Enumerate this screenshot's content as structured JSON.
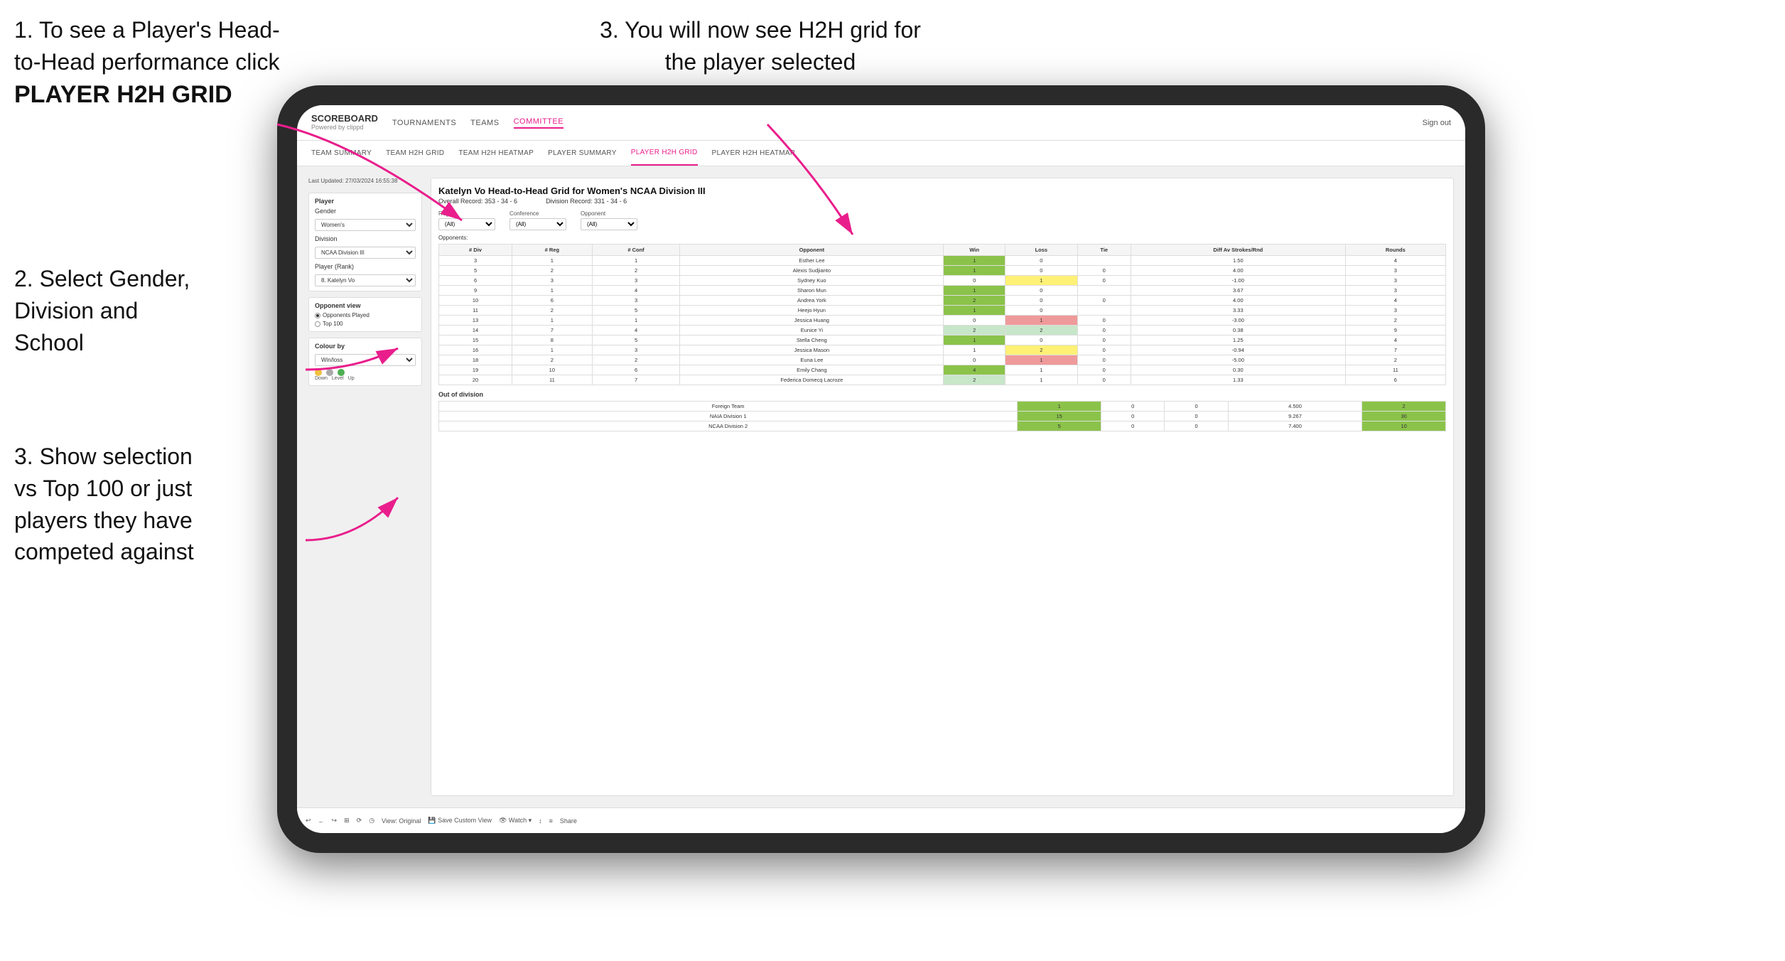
{
  "instructions": {
    "top_left_line1": "1. To see a Player's Head-",
    "top_left_line2": "to-Head performance click",
    "top_left_bold": "PLAYER H2H GRID",
    "top_right": "3. You will now see H2H grid for the player selected",
    "mid_left_line1": "2. Select Gender,",
    "mid_left_line2": "Division and",
    "mid_left_line3": "School",
    "bot_left_line1": "3. Show selection",
    "bot_left_line2": "vs Top 100 or just",
    "bot_left_line3": "players they have",
    "bot_left_line4": "competed against"
  },
  "nav": {
    "logo": "SCOREBOARD",
    "logo_sub": "Powered by clippd",
    "items": [
      "TOURNAMENTS",
      "TEAMS",
      "COMMITTEE"
    ],
    "active_item": "COMMITTEE",
    "sign_out": "Sign out"
  },
  "sub_nav": {
    "items": [
      "TEAM SUMMARY",
      "TEAM H2H GRID",
      "TEAM H2H HEATMAP",
      "PLAYER SUMMARY",
      "PLAYER H2H GRID",
      "PLAYER H2H HEATMAP"
    ],
    "active": "PLAYER H2H GRID"
  },
  "sidebar": {
    "timestamp": "Last Updated: 27/03/2024 16:55:38",
    "player_label": "Player",
    "gender_label": "Gender",
    "gender_value": "Women's",
    "division_label": "Division",
    "division_value": "NCAA Division III",
    "player_rank_label": "Player (Rank)",
    "player_rank_value": "8. Katelyn Vo",
    "opponent_view_label": "Opponent view",
    "radio_opponents": "Opponents Played",
    "radio_top100": "Top 100",
    "colour_by_label": "Colour by",
    "colour_value": "Win/loss",
    "legend_down": "Down",
    "legend_level": "Level",
    "legend_up": "Up"
  },
  "panel": {
    "title": "Katelyn Vo Head-to-Head Grid for Women's NCAA Division III",
    "overall_record": "Overall Record: 353 - 34 - 6",
    "division_record": "Division Record: 331 - 34 - 6",
    "filters": {
      "region_label": "Region",
      "conference_label": "Conference",
      "opponent_label": "Opponent",
      "opponents_label": "Opponents:",
      "region_value": "(All)",
      "conference_value": "(All)",
      "opponent_value": "(All)"
    },
    "table_headers": [
      "# Div",
      "# Reg",
      "# Conf",
      "Opponent",
      "Win",
      "Loss",
      "Tie",
      "Diff Av Strokes/Rnd",
      "Rounds"
    ],
    "rows": [
      {
        "div": "3",
        "reg": "1",
        "conf": "1",
        "opponent": "Esther Lee",
        "win": "1",
        "loss": "0",
        "tie": "",
        "diff": "1.50",
        "rounds": "4",
        "win_color": "green",
        "loss_color": "",
        "tie_color": ""
      },
      {
        "div": "5",
        "reg": "2",
        "conf": "2",
        "opponent": "Alexis Sudjianto",
        "win": "1",
        "loss": "0",
        "tie": "0",
        "diff": "4.00",
        "rounds": "3",
        "win_color": "green"
      },
      {
        "div": "6",
        "reg": "3",
        "conf": "3",
        "opponent": "Sydney Kuo",
        "win": "0",
        "loss": "1",
        "tie": "0",
        "diff": "-1.00",
        "rounds": "3",
        "loss_color": "yellow"
      },
      {
        "div": "9",
        "reg": "1",
        "conf": "4",
        "opponent": "Sharon Mun",
        "win": "1",
        "loss": "0",
        "tie": "",
        "diff": "3.67",
        "rounds": "3",
        "win_color": "green"
      },
      {
        "div": "10",
        "reg": "6",
        "conf": "3",
        "opponent": "Andrea York",
        "win": "2",
        "loss": "0",
        "tie": "0",
        "diff": "4.00",
        "rounds": "4",
        "win_color": "green"
      },
      {
        "div": "11",
        "reg": "2",
        "conf": "5",
        "opponent": "Heejo Hyun",
        "win": "1",
        "loss": "0",
        "tie": "",
        "diff": "3.33",
        "rounds": "3",
        "win_color": "green"
      },
      {
        "div": "13",
        "reg": "1",
        "conf": "1",
        "opponent": "Jessica Huang",
        "win": "0",
        "loss": "1",
        "tie": "0",
        "diff": "-3.00",
        "rounds": "2",
        "loss_color": "red"
      },
      {
        "div": "14",
        "reg": "7",
        "conf": "4",
        "opponent": "Eunice Yi",
        "win": "2",
        "loss": "2",
        "tie": "0",
        "diff": "0.38",
        "rounds": "9",
        "win_color": "light-green",
        "loss_color": "light-green"
      },
      {
        "div": "15",
        "reg": "8",
        "conf": "5",
        "opponent": "Stella Cheng",
        "win": "1",
        "loss": "0",
        "tie": "0",
        "diff": "1.25",
        "rounds": "4",
        "win_color": "green"
      },
      {
        "div": "16",
        "reg": "1",
        "conf": "3",
        "opponent": "Jessica Mason",
        "win": "1",
        "loss": "2",
        "tie": "0",
        "diff": "-0.94",
        "rounds": "7",
        "loss_color": "yellow"
      },
      {
        "div": "18",
        "reg": "2",
        "conf": "2",
        "opponent": "Euna Lee",
        "win": "0",
        "loss": "1",
        "tie": "0",
        "diff": "-5.00",
        "rounds": "2",
        "loss_color": "red"
      },
      {
        "div": "19",
        "reg": "10",
        "conf": "6",
        "opponent": "Emily Chang",
        "win": "4",
        "loss": "1",
        "tie": "0",
        "diff": "0.30",
        "rounds": "11",
        "win_color": "green"
      },
      {
        "div": "20",
        "reg": "11",
        "conf": "7",
        "opponent": "Federica Domecq Lacroze",
        "win": "2",
        "loss": "1",
        "tie": "0",
        "diff": "1.33",
        "rounds": "6",
        "win_color": "light-green"
      }
    ],
    "out_of_division_title": "Out of division",
    "out_of_division_rows": [
      {
        "name": "Foreign Team",
        "win": "1",
        "loss": "0",
        "tie": "0",
        "diff": "4.500",
        "rounds": "2"
      },
      {
        "name": "NAIA Division 1",
        "win": "15",
        "loss": "0",
        "tie": "0",
        "diff": "9.267",
        "rounds": "30"
      },
      {
        "name": "NCAA Division 2",
        "win": "5",
        "loss": "0",
        "tie": "0",
        "diff": "7.400",
        "rounds": "10"
      }
    ]
  },
  "toolbar": {
    "buttons": [
      "↩",
      "←",
      "↪",
      "⊞",
      "⟳",
      "◷",
      "View: Original",
      "Save Custom View",
      "👁 Watch ▾",
      "↕",
      "≡",
      "Share"
    ]
  }
}
